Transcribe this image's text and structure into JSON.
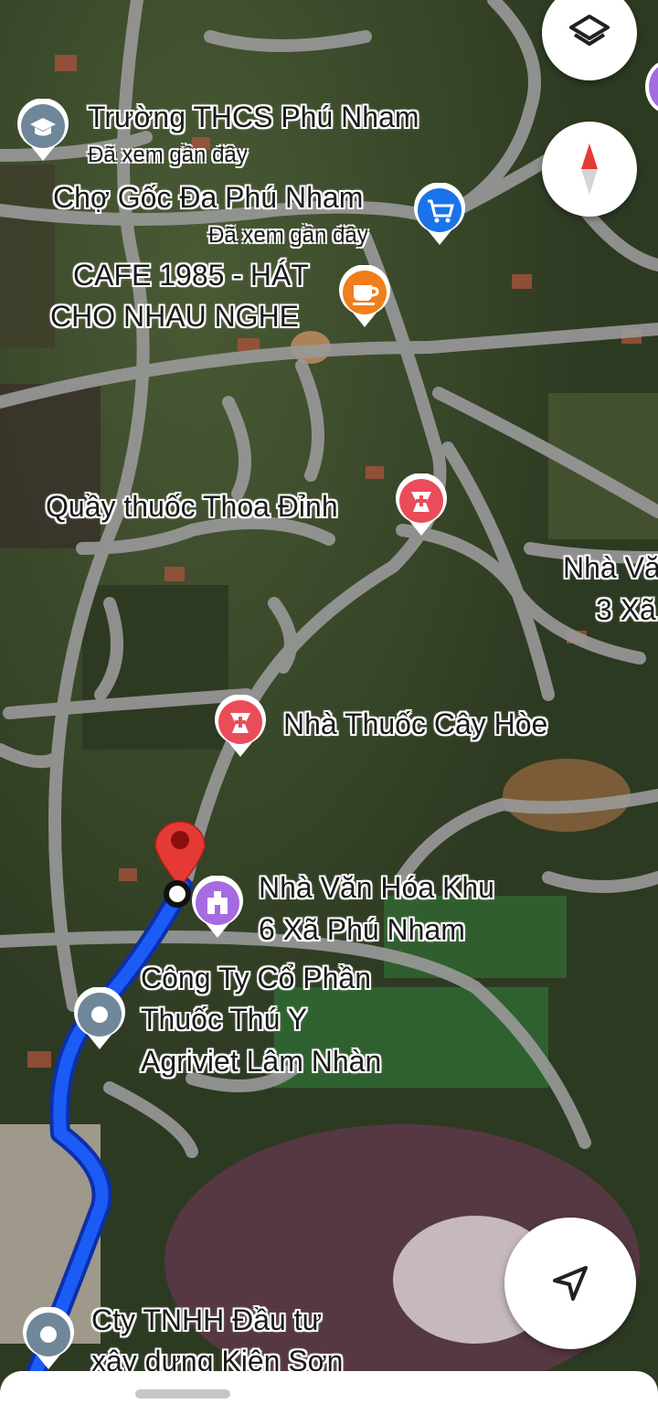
{
  "places": [
    {
      "id": "thcs",
      "name": "Trường THCS Phú Nham",
      "sub": "Đã xem gần đây",
      "icon": "school-icon",
      "color": "#6f8799"
    },
    {
      "id": "cho",
      "name": "Chợ Gốc Đa Phú Nham",
      "sub": "Đã xem gần đây",
      "icon": "shopping-cart-icon",
      "color": "#1a73e8"
    },
    {
      "id": "cafe",
      "name_line1": "CAFE 1985 - HÁT",
      "name_line2": "CHO NHAU NGHE",
      "icon": "coffee-cup-icon",
      "color": "#f17e1a"
    },
    {
      "id": "thoa",
      "name": "Quầy thuốc Thoa Đỉnh",
      "icon": "pharmacy-icon",
      "color": "#ea4c5a"
    },
    {
      "id": "nhava3",
      "name_line1": "Nhà Vă",
      "name_line2": "3 Xã"
    },
    {
      "id": "cayhoe",
      "name": "Nhà Thuốc Cây Hòe",
      "icon": "pharmacy-icon",
      "color": "#ea4c5a"
    },
    {
      "id": "vanhoa6",
      "name_line1": "Nhà Văn Hóa Khu",
      "name_line2": "6 Xã Phú Nham",
      "icon": "community-hall-icon",
      "color": "#a66be0"
    },
    {
      "id": "agriviet",
      "name_line1": "Công Ty Cổ Phần",
      "name_line2": "Thuốc Thú Y",
      "name_line3": "Agriviet Lâm Nhàn",
      "icon": "generic-place-icon",
      "color": "#6f8799"
    },
    {
      "id": "kienson",
      "name_line1": "Cty TNHH Đầu tư",
      "name_line2": "xây dựng Kiên Sơn",
      "icon": "generic-place-icon",
      "color": "#6f8799"
    }
  ],
  "route": {
    "color": "#1a5cf5",
    "outline": "#0d2fa8"
  },
  "destination_pin": {
    "color": "#e53935",
    "icon": "destination-pin-icon"
  },
  "controls": {
    "layers": "layers-icon",
    "compass": "compass-icon",
    "recenter": "navigation-arrow-icon"
  }
}
